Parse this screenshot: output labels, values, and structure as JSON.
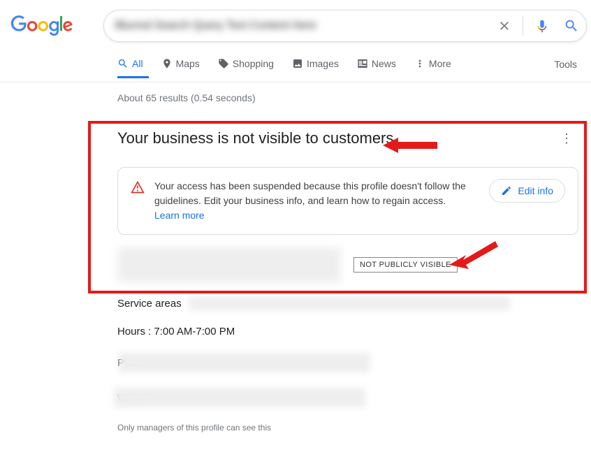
{
  "header": {
    "search_query_blurred": "Blurred Search Query Text Content Here",
    "clear_label": "Clear"
  },
  "tabs": {
    "all": "All",
    "maps": "Maps",
    "shopping": "Shopping",
    "images": "Images",
    "news": "News",
    "more": "More",
    "tools": "Tools"
  },
  "stats": "About 65 results (0.54 seconds)",
  "panel": {
    "title": "Your business is not visible to customers",
    "notice": "Your access has been suspended because this profile doesn't follow the guidelines. Edit your business info, and learn how to regain access. ",
    "learn_more": "Learn more",
    "edit_info": "Edit info",
    "npv": "NOT PUBLICLY VISIBLE"
  },
  "details": {
    "service_areas_label": "Service areas",
    "hours_label": "Hours",
    "hours_value": ": 7:00 AM-7:00 PM",
    "phone_label": "Phone",
    "website_label": "Websit"
  },
  "footer_note": "Only managers of this profile can see this"
}
